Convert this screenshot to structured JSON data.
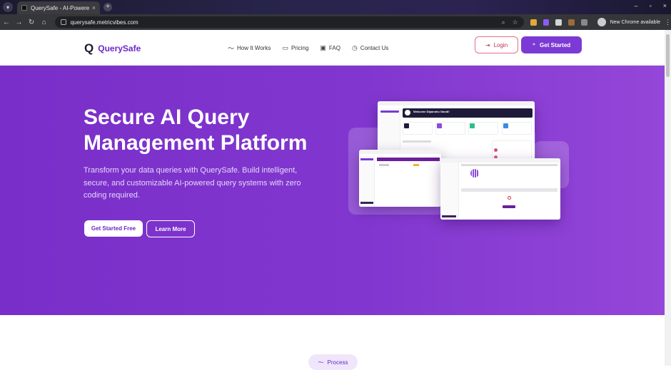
{
  "browser": {
    "tab_title": "QuerySafe - AI-Powered",
    "tab_close": "×",
    "new_tab": "+",
    "url": "querysafe.metricvibes.com",
    "new_chrome": "New Chrome available",
    "window_controls": [
      "–",
      "▫",
      "×"
    ]
  },
  "header": {
    "logo_mark": "Q",
    "logo_text": "QuerySafe",
    "nav": [
      {
        "label": "How It Works",
        "icon": "trend-icon"
      },
      {
        "label": "Pricing",
        "icon": "card-icon"
      },
      {
        "label": "FAQ",
        "icon": "book-icon"
      },
      {
        "label": "Contact Us",
        "icon": "clock-icon"
      }
    ],
    "login": "Login",
    "get_started": "Get Started"
  },
  "hero": {
    "title": "Secure AI Query Management Platform",
    "subtitle": "Transform your data queries with QuerySafe. Build intelligent, secure, and customizable AI-powered query systems with zero coding required.",
    "primary_cta": "Get Started Free",
    "secondary_cta": "Learn More",
    "mock_welcome": "Welcome Dipanshu Gandi!"
  },
  "process_pill": "Process",
  "colors": {
    "brand": "#7b3ad4",
    "hero_bg": "#8137cf",
    "login_border": "#e56f8a"
  }
}
